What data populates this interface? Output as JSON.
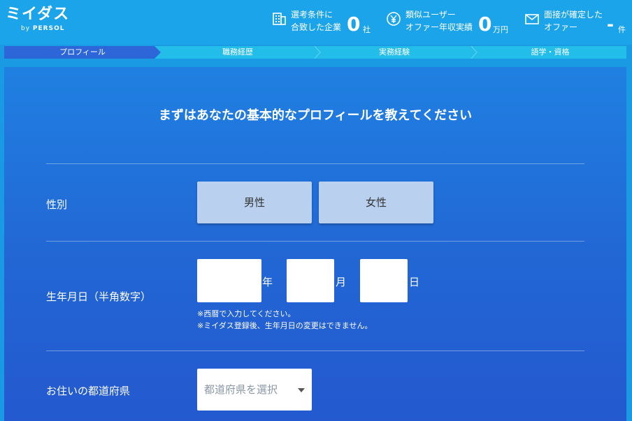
{
  "header": {
    "logo_main": "ミイダス",
    "logo_by": "by",
    "logo_brand": "PERSOL",
    "stats": [
      {
        "icon": "building-icon",
        "label_lines": [
          "選考条件に",
          "合致した企業"
        ],
        "value": "0",
        "unit": "社"
      },
      {
        "icon": "yen-icon",
        "label_lines": [
          "類似ユーザー",
          "オファー年収実績"
        ],
        "value": "0",
        "unit": "万円"
      },
      {
        "icon": "mail-icon",
        "label_lines": [
          "面接が確定した",
          "オファー"
        ],
        "value": "-",
        "unit": "件"
      }
    ]
  },
  "steps": [
    "プロフィール",
    "職務経歴",
    "実務経験",
    "語学・資格"
  ],
  "form": {
    "title": "まずはあなたの基本的なプロフィールを教えてください",
    "gender": {
      "label": "性別",
      "options": [
        "男性",
        "女性"
      ]
    },
    "birth": {
      "label": "生年月日（半角数字）",
      "units": [
        "年",
        "月",
        "日"
      ],
      "notes": [
        "※西暦で入力してください。",
        "※ミイダス登録後、生年月日の変更はできません。"
      ]
    },
    "prefecture": {
      "label": "お住いの都道府県",
      "placeholder": "都道府県を選択"
    }
  },
  "colors": {
    "header": "#1ba4ea",
    "step_active": "#2c66d9",
    "panel": "#2266d4",
    "button": "#b9d1ee"
  }
}
